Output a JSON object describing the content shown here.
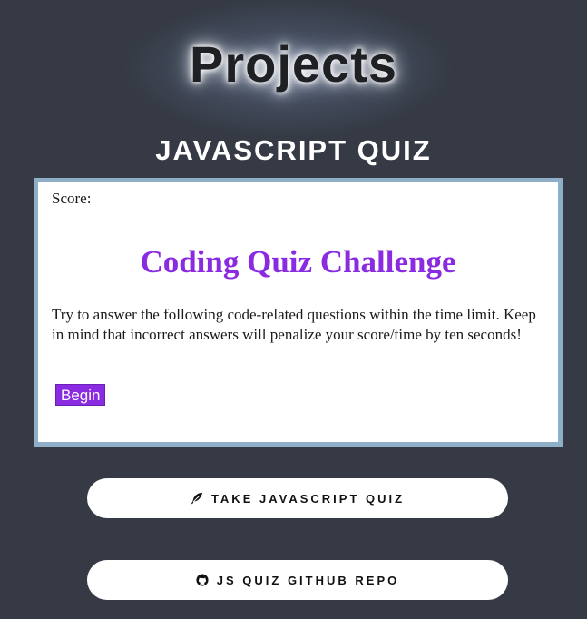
{
  "header": {
    "title": "Projects"
  },
  "section": {
    "title": "JAVASCRIPT QUIZ"
  },
  "quiz": {
    "score_label": "Score:",
    "heading": "Coding Quiz Challenge",
    "description": "Try to answer the following code-related questions within the time limit. Keep in mind that incorrect answers will penalize your score/time by ten seconds!",
    "begin_label": "Begin"
  },
  "buttons": {
    "take_quiz": {
      "label": "TAKE JAVASCRIPT QUIZ",
      "icon": "feather-icon"
    },
    "github_repo": {
      "label": "JS QUIZ GITHUB REPO",
      "icon": "github-icon"
    }
  },
  "colors": {
    "background": "#353a44",
    "accent": "#8a2be2",
    "frame_border": "#8fafc8"
  }
}
